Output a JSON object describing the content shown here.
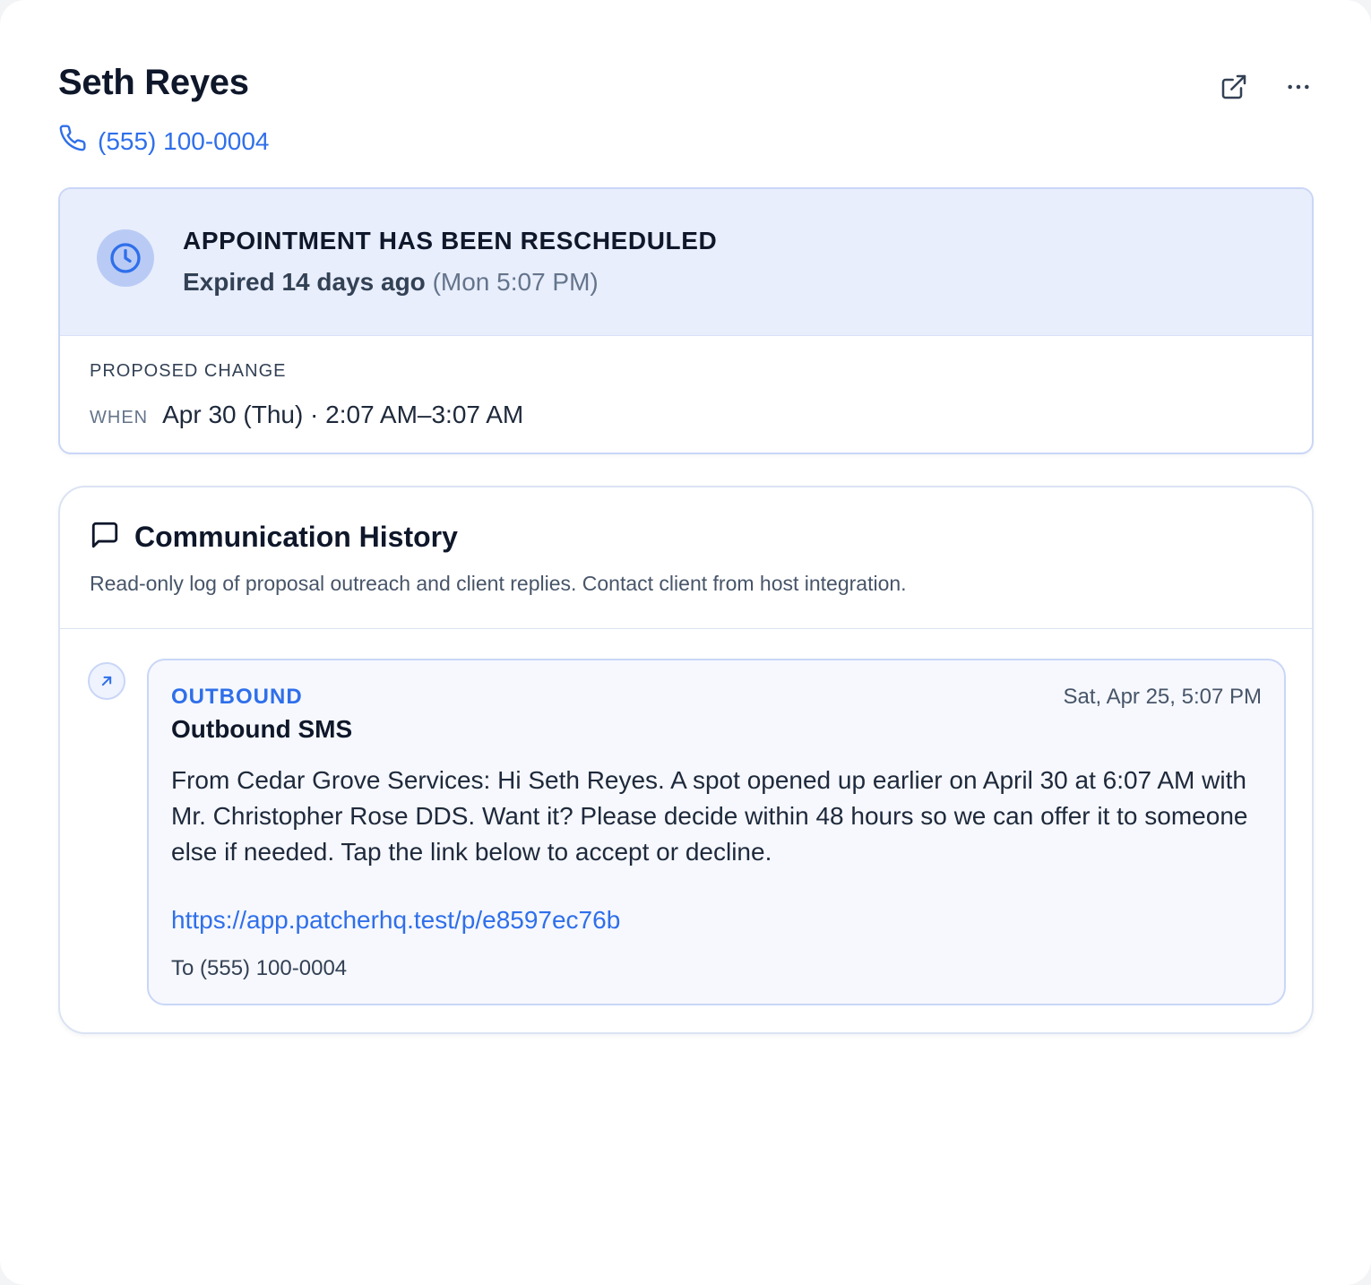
{
  "contact": {
    "name": "Seth Reyes",
    "phone": "(555) 100-0004"
  },
  "header_actions": {
    "open_icon": "external-link-icon",
    "more_icon": "more-horizontal-icon"
  },
  "status": {
    "icon": "clock-icon",
    "title": "APPOINTMENT HAS BEEN RESCHEDULED",
    "expired": "Expired 14 days ago",
    "expired_time": "(Mon 5:07 PM)"
  },
  "proposed": {
    "label": "PROPOSED CHANGE",
    "when_label": "WHEN",
    "when_value": "Apr 30 (Thu) · 2:07 AM–3:07 AM"
  },
  "history": {
    "icon": "message-square-icon",
    "title": "Communication History",
    "description": "Read-only log of proposal outreach and client replies. Contact client from host integration.",
    "messages": [
      {
        "direction": "OUTBOUND",
        "direction_icon": "arrow-up-right-icon",
        "timestamp": "Sat, Apr 25, 5:07 PM",
        "title": "Outbound SMS",
        "body": "From Cedar Grove Services: Hi Seth Reyes. A spot opened up earlier on April 30 at 6:07 AM with Mr. Christopher Rose DDS. Want it? Please decide within 48 hours so we can offer it to someone else if needed. Tap the link below to accept or decline.",
        "link": "https://app.patcherhq.test/p/e8597ec76b",
        "to": "To (555) 100-0004"
      }
    ]
  },
  "colors": {
    "accent": "#2f6fea",
    "status_bg": "#e8eefc",
    "status_icon_bg": "#b9cbf5",
    "message_bg": "#f6f8fd",
    "border": "#c9d6f7"
  }
}
